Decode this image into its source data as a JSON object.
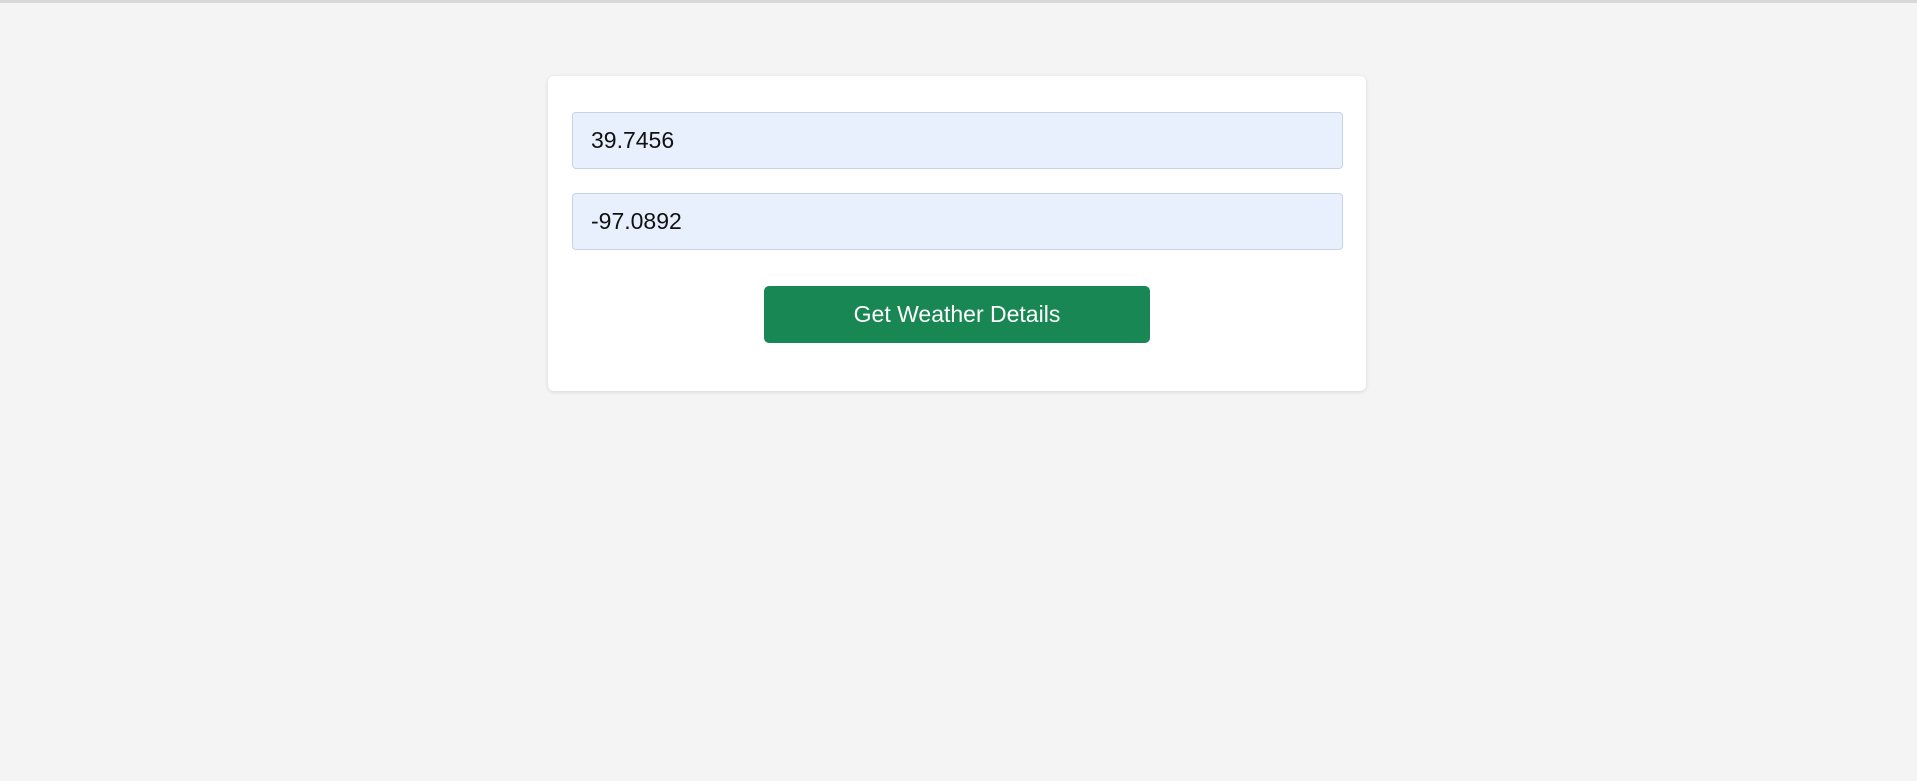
{
  "form": {
    "latitude": {
      "value": "39.7456"
    },
    "longitude": {
      "value": "-97.0892"
    },
    "submit_label": "Get Weather Details"
  },
  "colors": {
    "page_background": "#f4f4f4",
    "card_background": "#ffffff",
    "input_background": "#e8f0fe",
    "input_border": "#c9d3e6",
    "button_background": "#198754",
    "button_text": "#ffffff"
  }
}
